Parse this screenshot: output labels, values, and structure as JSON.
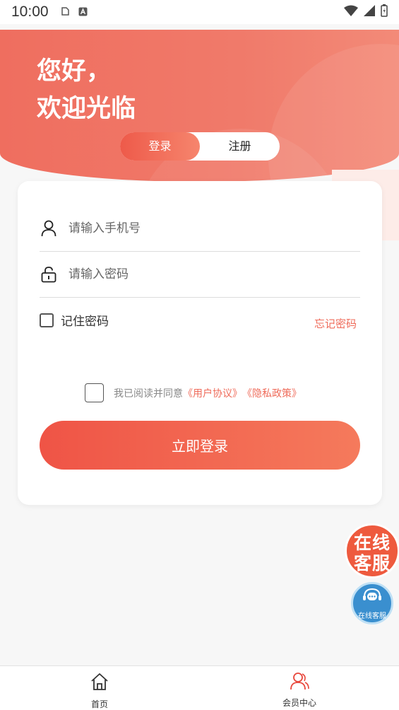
{
  "status_bar": {
    "time": "10:00"
  },
  "hero": {
    "greeting": "您好，",
    "welcome": "欢迎光临"
  },
  "tabs": {
    "login": "登录",
    "register": "注册"
  },
  "form": {
    "phone_placeholder": "请输入手机号",
    "password_placeholder": "请输入密码",
    "remember_label": "记住密码",
    "remember_checked": false,
    "forgot_label": "忘记密码",
    "agree_prefix": "我已阅读并同意",
    "user_agreement": "《用户协议》",
    "privacy_policy": "《隐私政策》",
    "agree_checked": false,
    "submit_label": "立即登录"
  },
  "customer_service": {
    "badge_text": "在线客服",
    "button_label": "在线客服"
  },
  "bottom_nav": {
    "items": [
      {
        "label": "首页",
        "icon": "home-icon"
      },
      {
        "label": "会员中心",
        "icon": "user-icon"
      }
    ]
  },
  "colors": {
    "accent": "#ef6b5a",
    "accent_dark": "#ee5a4a",
    "cs_blue": "#3a8fcf"
  }
}
